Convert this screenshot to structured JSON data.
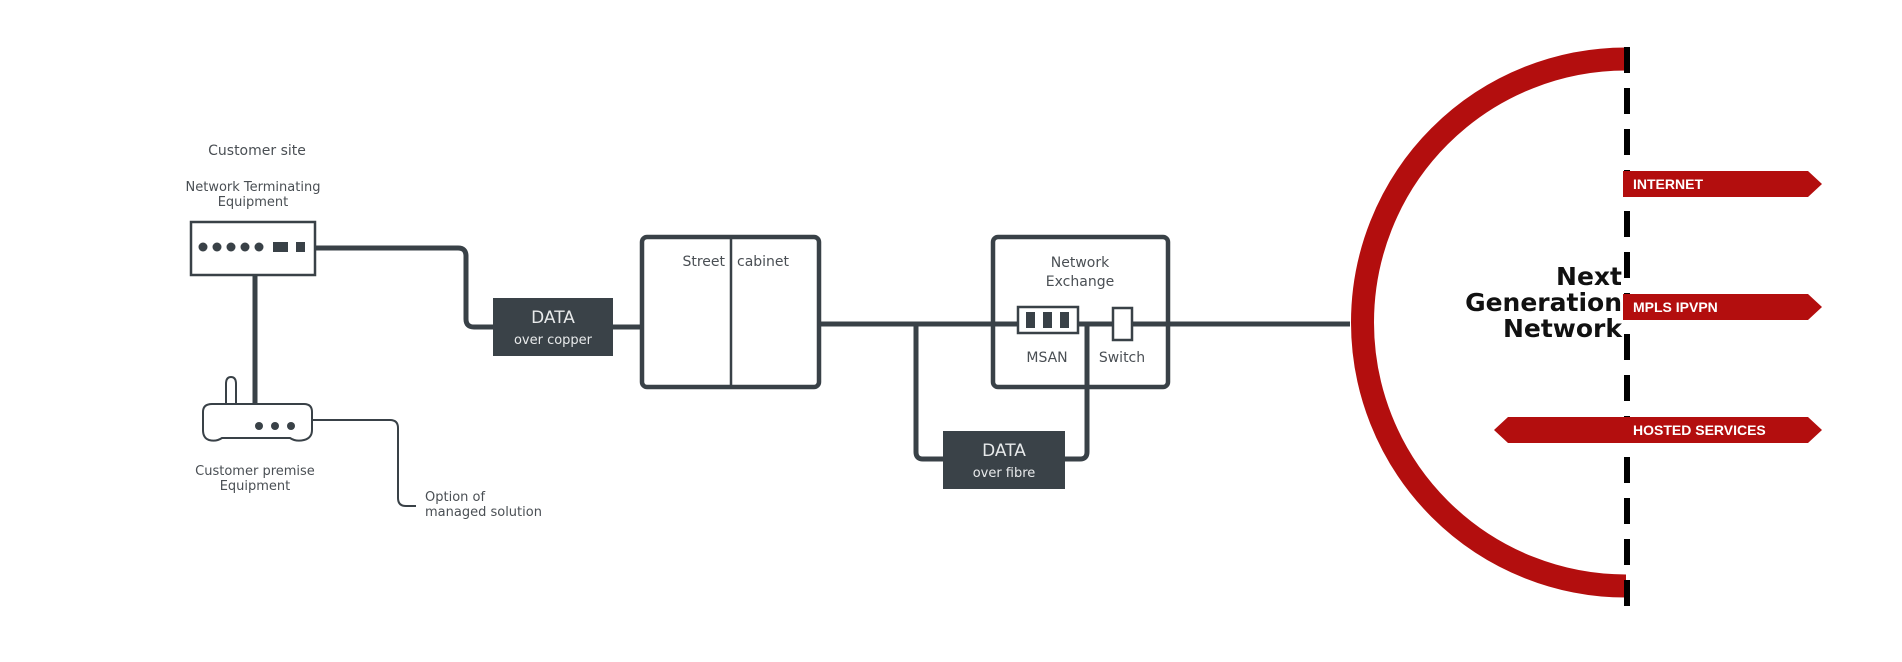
{
  "colors": {
    "line": "#394147",
    "box_fill": "#3a4248",
    "accent_red": "#b30e0e",
    "dashed": "#000000"
  },
  "customer_site": {
    "heading": "Customer site",
    "nte_label_line1": "Network Terminating",
    "nte_label_line2": "Equipment",
    "cpe_label_line1": "Customer premise",
    "cpe_label_line2": "Equipment",
    "managed_line1": "Option of",
    "managed_line2": "managed solution"
  },
  "copper_box": {
    "title": "DATA",
    "subtitle": "over copper"
  },
  "street_cabinet": {
    "left_label": "Street",
    "right_label": "cabinet"
  },
  "exchange": {
    "title_line1": "Network",
    "title_line2": "Exchange",
    "msan_label": "MSAN",
    "switch_label": "Switch"
  },
  "fibre_box": {
    "title": "DATA",
    "subtitle": "over fibre"
  },
  "ngn": {
    "line1": "Next",
    "line2": "Generation",
    "line3": "Network"
  },
  "services": [
    {
      "label": "INTERNET",
      "direction": "out"
    },
    {
      "label": "MPLS IPVPN",
      "direction": "out"
    },
    {
      "label": "HOSTED SERVICES",
      "direction": "both"
    }
  ]
}
